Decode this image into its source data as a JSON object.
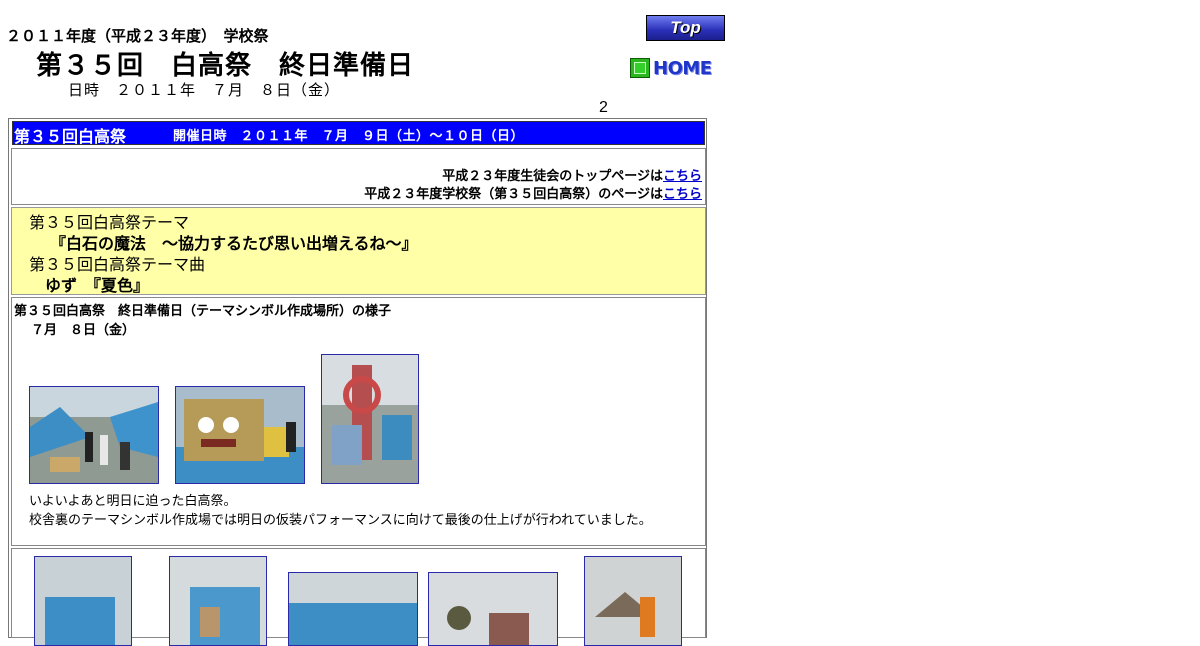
{
  "header": {
    "year_line": "２０１１年度（平成２３年度）　学校祭",
    "title": "第３５回　白高祭　終日準備日",
    "date_line": "日時　２０１１年　７月　８日（金）",
    "page_number": "2"
  },
  "nav": {
    "top_label": "Top",
    "home_label": "HOME"
  },
  "banner": {
    "title": "第３５回白高祭",
    "dates": "開催日時　２０１１年　７月　９日（土）～１０日（日）"
  },
  "links": [
    {
      "prefix": "平成２３年度生徒会のトップページは",
      "link": "こちら"
    },
    {
      "prefix": "平成２３年度学校祭（第３５回白高祭）のページは",
      "link": "こちら"
    }
  ],
  "theme": {
    "theme_heading": "第３５回白高祭テーマ",
    "theme_text": "『白石の魔法　～協力するたび思い出増えるね～』",
    "song_heading": "第３５回白高祭テーマ曲",
    "song_text": "ゆず　『夏色』"
  },
  "section": {
    "heading": "第３５回白高祭　終日準備日（テーマシンボル作成場所）の様子",
    "date": "７月　８日（金）",
    "caption1": "いよいよあと明日に迫った白高祭。",
    "caption2": "校舎裏のテーマシンボル作成場では明日の仮装パフォーマンスに向けて最後の仕上げが行われていました。"
  },
  "colors": {
    "banner_bg": "#0000ff",
    "theme_bg": "#ffffa8",
    "link": "#0000cc"
  }
}
